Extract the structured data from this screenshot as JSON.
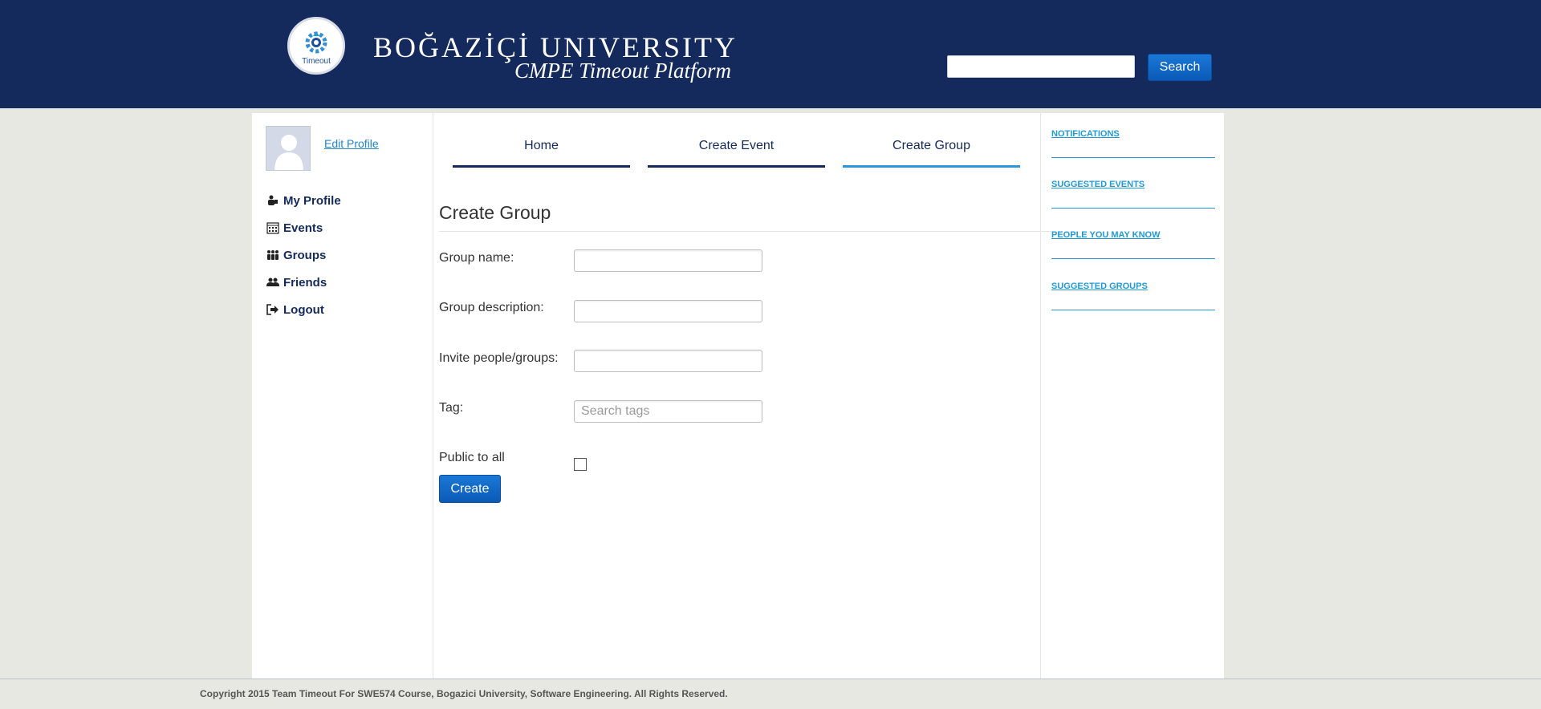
{
  "header": {
    "logo_word": "Timeout",
    "university_name": "BOĞAZİÇİ UNIVERSITY",
    "platform_name": "CMPE Timeout Platform",
    "search_value": "",
    "search_label": "Search"
  },
  "sidebar": {
    "edit_profile": "Edit Profile",
    "items": [
      {
        "label": "My Profile",
        "icon": "user-icon"
      },
      {
        "label": "Events",
        "icon": "calendar-icon"
      },
      {
        "label": "Groups",
        "icon": "groups-icon"
      },
      {
        "label": "Friends",
        "icon": "friends-icon"
      },
      {
        "label": "Logout",
        "icon": "logout-icon"
      }
    ]
  },
  "tabs": [
    {
      "label": "Home",
      "active": false
    },
    {
      "label": "Create Event",
      "active": false
    },
    {
      "label": "Create Group",
      "active": true
    }
  ],
  "form": {
    "title": "Create Group",
    "group_name_label": "Group name:",
    "group_name_value": "",
    "description_label": "Group description:",
    "description_value": "",
    "invite_label": "Invite people/groups:",
    "invite_value": "",
    "tag_label": "Tag:",
    "tag_placeholder": "Search tags",
    "public_label": "Public to all",
    "public_checked": false,
    "create_label": "Create"
  },
  "right_panel": {
    "links": [
      "NOTIFICATIONS",
      "SUGGESTED EVENTS",
      "PEOPLE YOU MAY KNOW",
      "SUGGESTED GROUPS"
    ]
  },
  "footer": {
    "copyright": "Copyright 2015 Team Timeout For SWE574 Course, Bogazici University, Software Engineering. All Rights Reserved."
  },
  "colors": {
    "header_bg": "#14295c",
    "accent": "#2a96dc",
    "button": "#0b5ab7",
    "page_bg": "#e8e8e3"
  }
}
